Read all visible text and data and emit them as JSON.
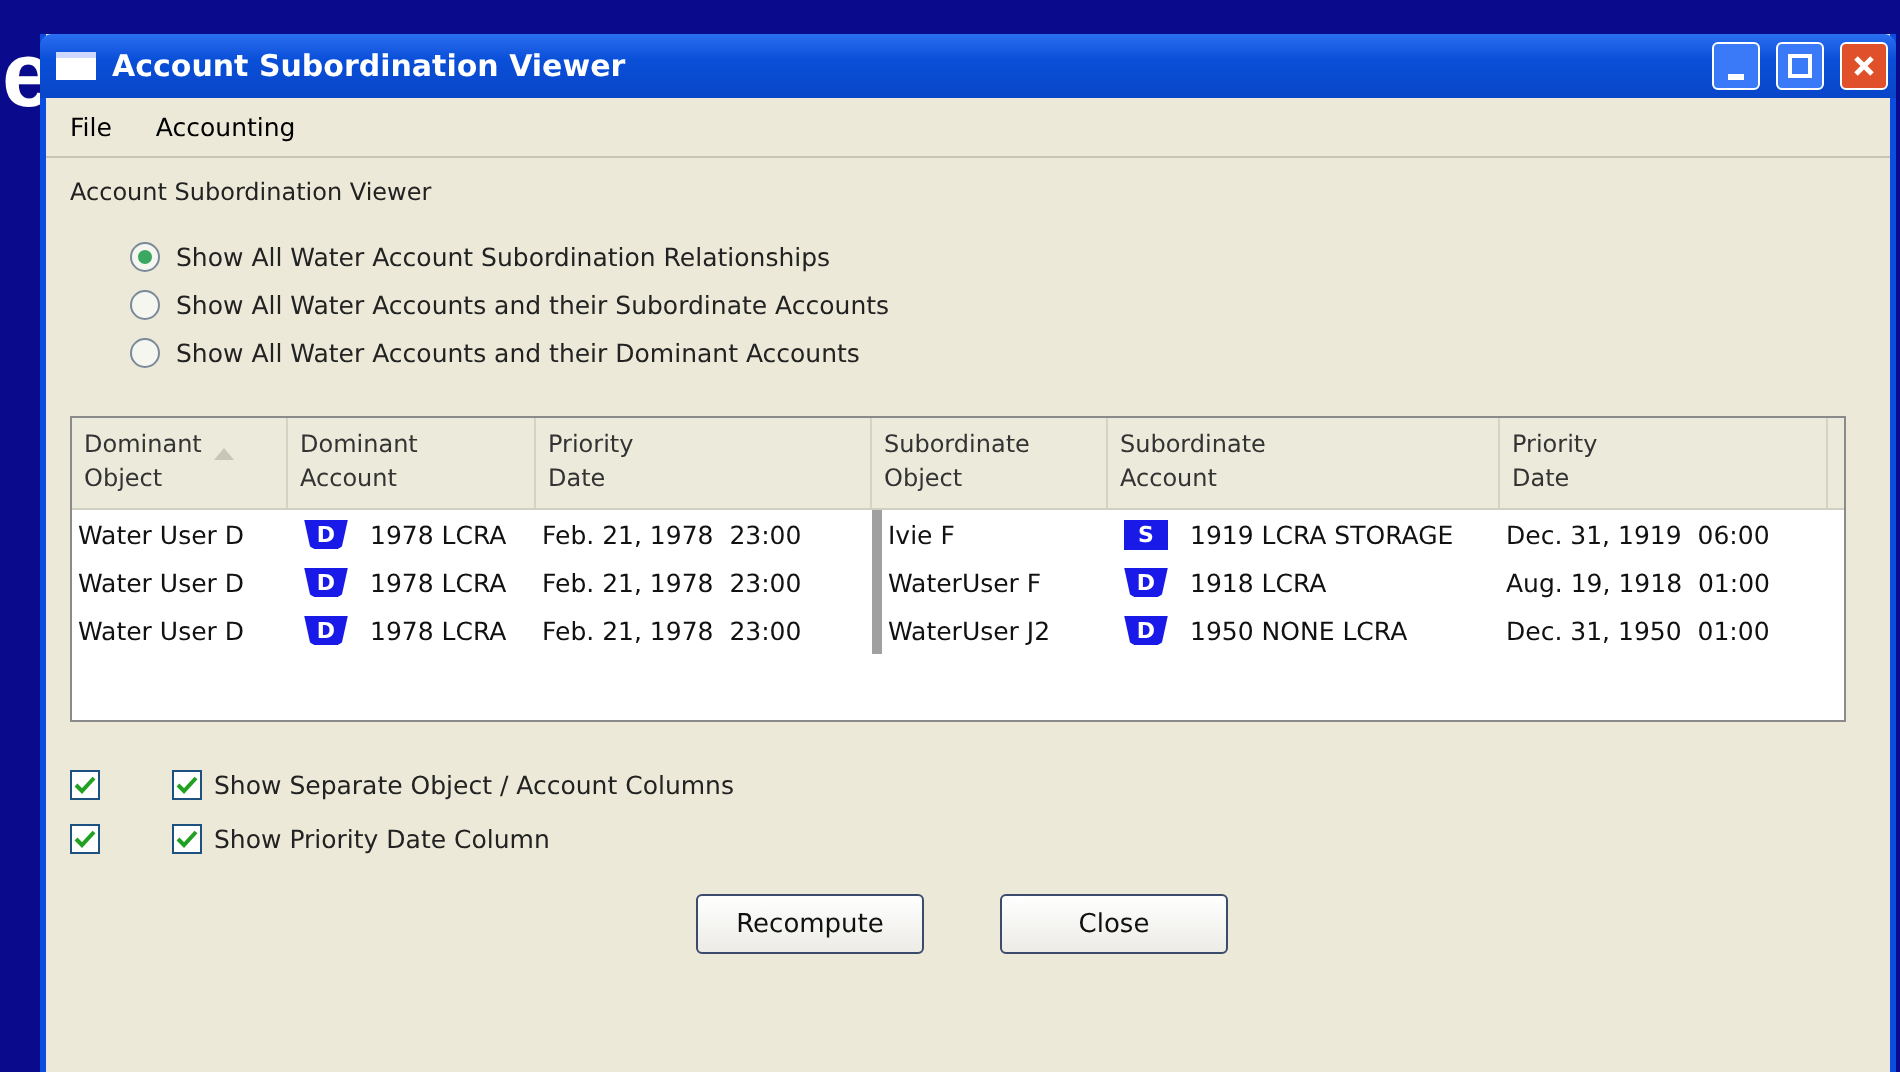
{
  "slide_fragment": "e",
  "window": {
    "title": "Account Subordination Viewer"
  },
  "menu": [
    "File",
    "Accounting"
  ],
  "section_label": "Account Subordination Viewer",
  "options": [
    {
      "label": "Show All Water Account Subordination Relationships",
      "selected": true
    },
    {
      "label": "Show All Water Accounts and their Subordinate Accounts",
      "selected": false
    },
    {
      "label": "Show All Water Accounts and their Dominant Accounts",
      "selected": false
    }
  ],
  "table": {
    "columns": [
      {
        "label": "Dominant\nObject",
        "sorted": true
      },
      {
        "label": "Dominant\nAccount",
        "sorted": false
      },
      {
        "label": "Priority\nDate",
        "sorted": false
      },
      {
        "label": "Subordinate\nObject",
        "sorted": false
      },
      {
        "label": "Subordinate\nAccount",
        "sorted": false
      },
      {
        "label": "Priority\nDate",
        "sorted": false
      }
    ],
    "rows": [
      {
        "dominant_object": "Water User D",
        "dominant_account": {
          "badge": "D",
          "kind": "shield",
          "name": "1978 LCRA"
        },
        "dominant_date": "Feb. 21, 1978  23:00",
        "subordinate_object": "Ivie F",
        "subordinate_account": {
          "badge": "S",
          "kind": "square",
          "name": "1919 LCRA STORAGE"
        },
        "subordinate_date": "Dec. 31, 1919  06:00"
      },
      {
        "dominant_object": "Water User D",
        "dominant_account": {
          "badge": "D",
          "kind": "shield",
          "name": "1978 LCRA"
        },
        "dominant_date": "Feb. 21, 1978  23:00",
        "subordinate_object": "WaterUser F",
        "subordinate_account": {
          "badge": "D",
          "kind": "shield",
          "name": "1918 LCRA"
        },
        "subordinate_date": "Aug. 19, 1918  01:00"
      },
      {
        "dominant_object": "Water User D",
        "dominant_account": {
          "badge": "D",
          "kind": "shield",
          "name": "1978 LCRA"
        },
        "dominant_date": "Feb. 21, 1978  23:00",
        "subordinate_object": "WaterUser J2",
        "subordinate_account": {
          "badge": "D",
          "kind": "shield",
          "name": "1950 NONE LCRA"
        },
        "subordinate_date": "Dec. 31, 1950  01:00"
      }
    ]
  },
  "checkbox_rows": [
    {
      "outer_checked": true,
      "checked": true,
      "label": "Show Separate Object / Account Columns"
    },
    {
      "outer_checked": true,
      "checked": true,
      "label": "Show Priority Date Column"
    }
  ],
  "buttons": [
    "Recompute",
    "Close"
  ]
}
